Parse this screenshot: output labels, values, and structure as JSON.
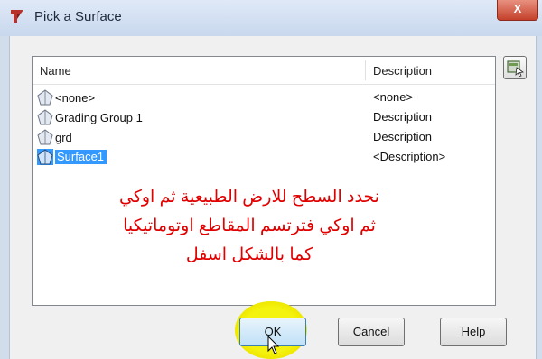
{
  "window": {
    "title": "Pick a Surface",
    "close_label": "X"
  },
  "list": {
    "headers": {
      "name": "Name",
      "description": "Description"
    },
    "rows": [
      {
        "name": "<none>",
        "description": "<none>",
        "icon": "surface-icon"
      },
      {
        "name": "Grading Group 1",
        "description": "Description",
        "icon": "surface-icon"
      },
      {
        "name": "grd",
        "description": "Description",
        "icon": "surface-icon"
      },
      {
        "name": "Surface1",
        "description": "<Description>",
        "icon": "surface-icon",
        "selected": true
      }
    ]
  },
  "annotation": {
    "lines": [
      "نحدد السطح للارض الطبيعية ثم اوكي",
      "ثم اوكي فترتسم المقاطع اوتوماتيكيا",
      "كما بالشكل اسفل"
    ],
    "color": "#e00000"
  },
  "buttons": {
    "ok": "OK",
    "cancel": "Cancel",
    "help": "Help"
  },
  "colors": {
    "selection": "#3399ff",
    "highlight": "#f4f20f",
    "close": "#c4412b"
  }
}
